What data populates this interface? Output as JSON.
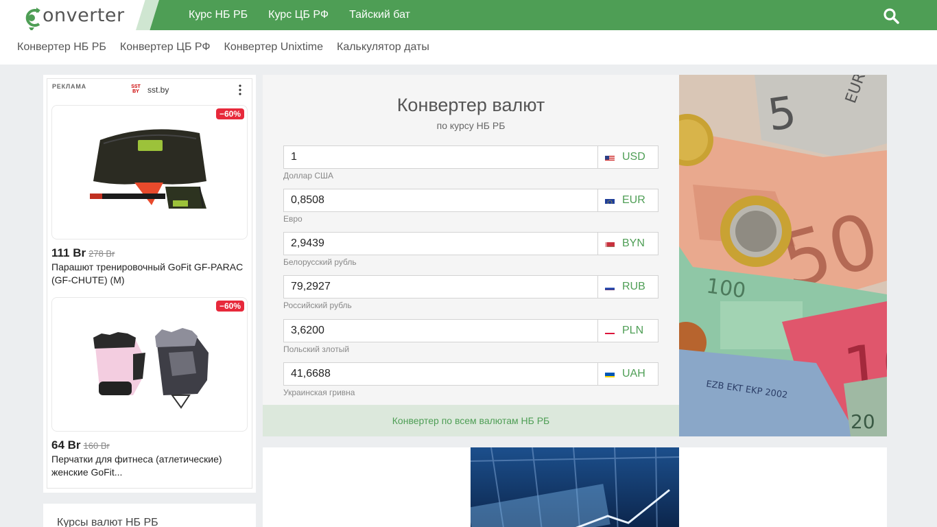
{
  "header": {
    "logo_text": "onverter",
    "nav": [
      "Курс НБ РБ",
      "Курс ЦБ РФ",
      "Тайский бат"
    ]
  },
  "subnav": [
    "Конвертер НБ РБ",
    "Конвертер ЦБ РФ",
    "Конвертер Unixtime",
    "Калькулятор даты"
  ],
  "ad": {
    "label": "РЕКЛАМА",
    "source": "sst.by",
    "source_logo": "SST BY",
    "products": [
      {
        "discount": "−60%",
        "price": "111 Br",
        "old_price": "278 Br",
        "title": "Парашют тренировочный GoFit GF-PARAC (GF-CHUTE) (M)"
      },
      {
        "discount": "−60%",
        "price": "64 Br",
        "old_price": "160 Br",
        "title": "Перчатки для фитнеса (атлетические) женские GoFit..."
      }
    ]
  },
  "rates_box": {
    "title": "Курсы валют НБ РБ"
  },
  "converter": {
    "title": "Конвертер валют",
    "subtitle": "по курсу НБ РБ",
    "rows": [
      {
        "value": "1",
        "code": "USD",
        "name": "Доллар США"
      },
      {
        "value": "0,8508",
        "code": "EUR",
        "name": "Евро"
      },
      {
        "value": "2,9439",
        "code": "BYN",
        "name": "Белорусский рубль"
      },
      {
        "value": "79,2927",
        "code": "RUB",
        "name": "Российский рубль"
      },
      {
        "value": "3,6200",
        "code": "PLN",
        "name": "Польский злотый"
      },
      {
        "value": "41,6688",
        "code": "UAH",
        "name": "Украинская гривна"
      }
    ],
    "footer_link": "Конвертер по всем валютам НБ РБ"
  },
  "icons": {
    "search": "search-icon",
    "menu": "more-vertical-icon"
  },
  "colors": {
    "brand": "#4e9e55",
    "discount": "#e7293b"
  }
}
